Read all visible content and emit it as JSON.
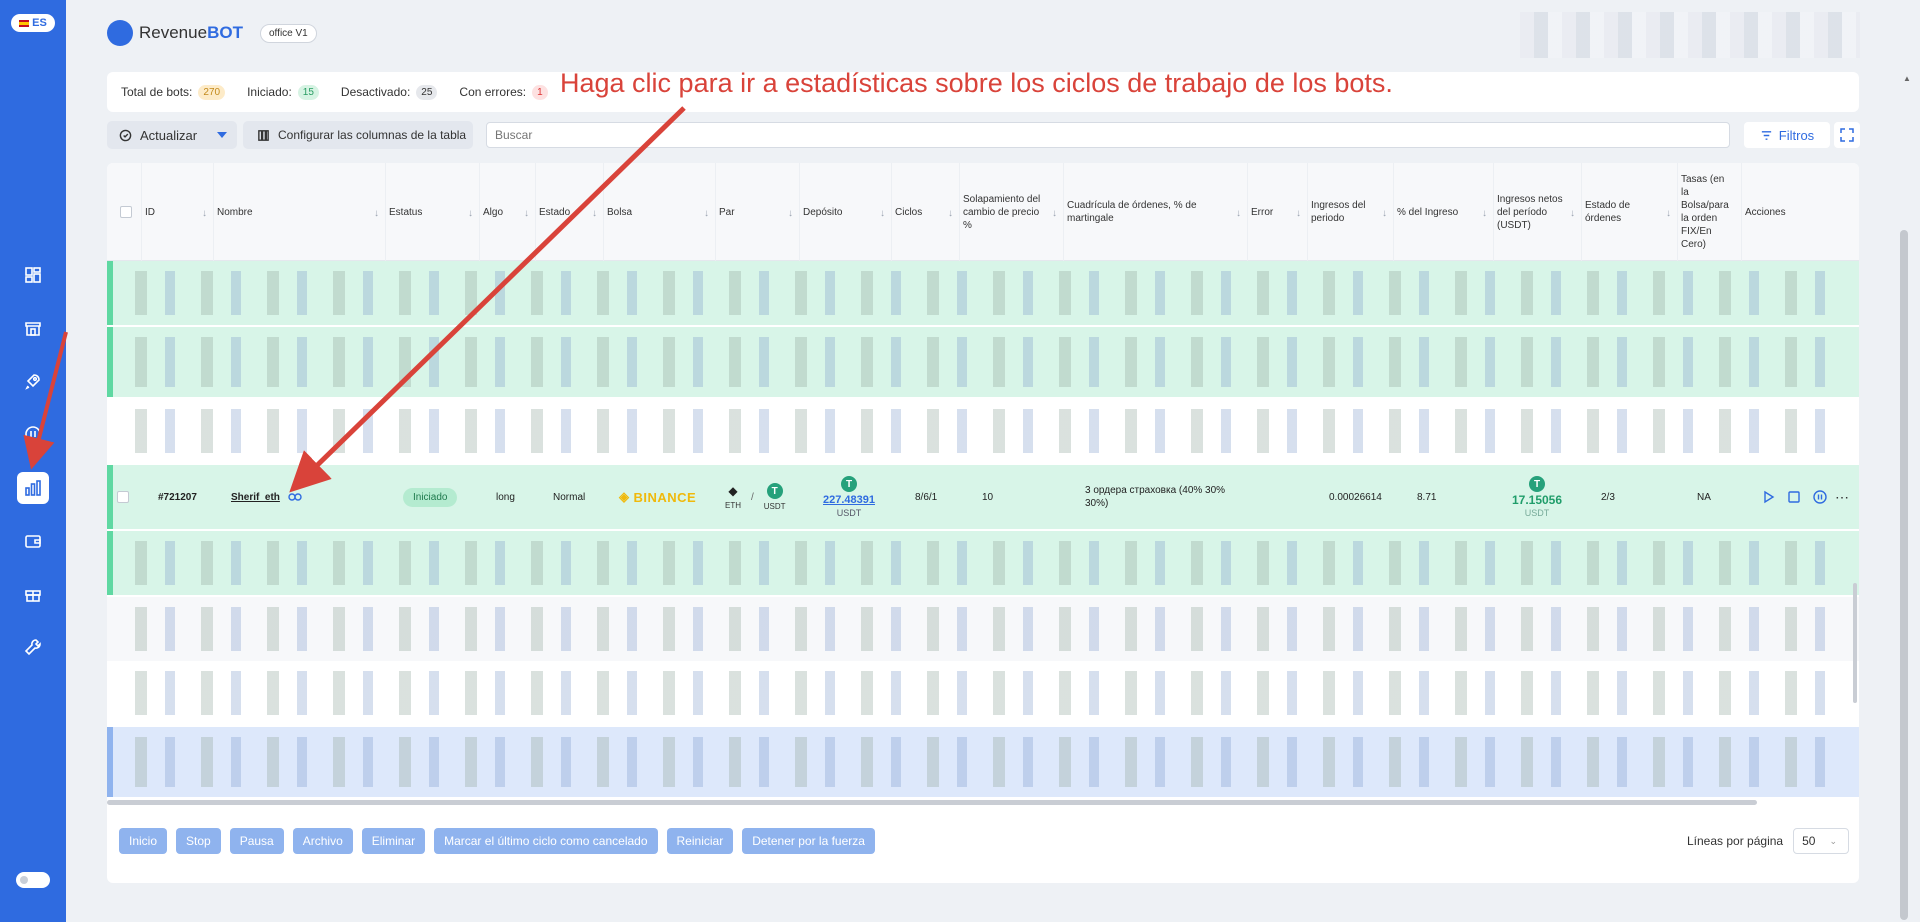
{
  "sidebar": {
    "lang": "ES",
    "nav": [
      {
        "icon": "dashboard-icon"
      },
      {
        "icon": "store-icon"
      },
      {
        "icon": "rocket-icon"
      },
      {
        "icon": "pause-circle-icon"
      },
      {
        "icon": "bar-chart-icon",
        "active": true
      },
      {
        "icon": "wallet-icon"
      },
      {
        "icon": "gift-icon"
      },
      {
        "icon": "wrench-icon"
      }
    ]
  },
  "header": {
    "logo_revenue": "Revenue",
    "logo_bot": "BOT",
    "office_badge": "office V1"
  },
  "stats": {
    "total_label": "Total de bots:",
    "total_value": "270",
    "started_label": "Iniciado:",
    "started_value": "15",
    "disabled_label": "Desactivado:",
    "disabled_value": "25",
    "errors_label": "Con errores:",
    "errors_value": "1"
  },
  "annotation": "Haga clic para ir a estadísticas sobre los ciclos de trabajo de los bots.",
  "toolbar": {
    "update_label": "Actualizar",
    "columns_label": "Configurar las columnas de la tabla",
    "search_placeholder": "Buscar",
    "filters_label": "Filtros"
  },
  "columns": [
    {
      "key": "id",
      "label": "ID"
    },
    {
      "key": "name",
      "label": "Nombre"
    },
    {
      "key": "status",
      "label": "Estatus"
    },
    {
      "key": "algo",
      "label": "Algo"
    },
    {
      "key": "state",
      "label": "Estado"
    },
    {
      "key": "exchange",
      "label": "Bolsa"
    },
    {
      "key": "pair",
      "label": "Par"
    },
    {
      "key": "deposit",
      "label": "Depósito"
    },
    {
      "key": "cycles",
      "label": "Ciclos"
    },
    {
      "key": "overlap",
      "label": "Solapamiento del cambio de precio %"
    },
    {
      "key": "grid",
      "label": "Cuadrícula de órdenes, % de martingale"
    },
    {
      "key": "error",
      "label": "Error"
    },
    {
      "key": "income",
      "label": "Ingresos del periodo"
    },
    {
      "key": "income_pct",
      "label": "% del Ingreso"
    },
    {
      "key": "net_income",
      "label": "Ingresos netos del período (USDT)"
    },
    {
      "key": "orders_state",
      "label": "Estado de órdenes"
    },
    {
      "key": "fees",
      "label": "Tasas (en la Bolsa/para la orden FIX/En Cero)"
    },
    {
      "key": "actions",
      "label": "Acciones"
    }
  ],
  "highlight_row": {
    "id": "#721207",
    "name": "Sherif_eth",
    "status": "Iniciado",
    "algo": "long",
    "state": "Normal",
    "exchange": "BINANCE",
    "base": "ETH",
    "quote": "USDT",
    "deposit": "227.48391",
    "deposit_unit": "USDT",
    "cycles": "8/6/1",
    "overlap": "10",
    "grid": "3 ордера страховка (40% 30% 30%)",
    "income": "0.00026614",
    "income_pct": "8.71",
    "net_income": "17.15056",
    "net_income_unit": "USDT",
    "orders_state": "2/3",
    "fees": "NA"
  },
  "bottom_buttons": [
    "Inicio",
    "Stop",
    "Pausa",
    "Archivo",
    "Eliminar",
    "Marcar el último ciclo como cancelado",
    "Reiniciar",
    "Detener por la fuerza"
  ],
  "pagination": {
    "label": "Líneas por página",
    "value": "50"
  },
  "colors": {
    "brand": "#2f6be0",
    "row_active": "#d8f5e8",
    "annotation": "#d9433a"
  }
}
